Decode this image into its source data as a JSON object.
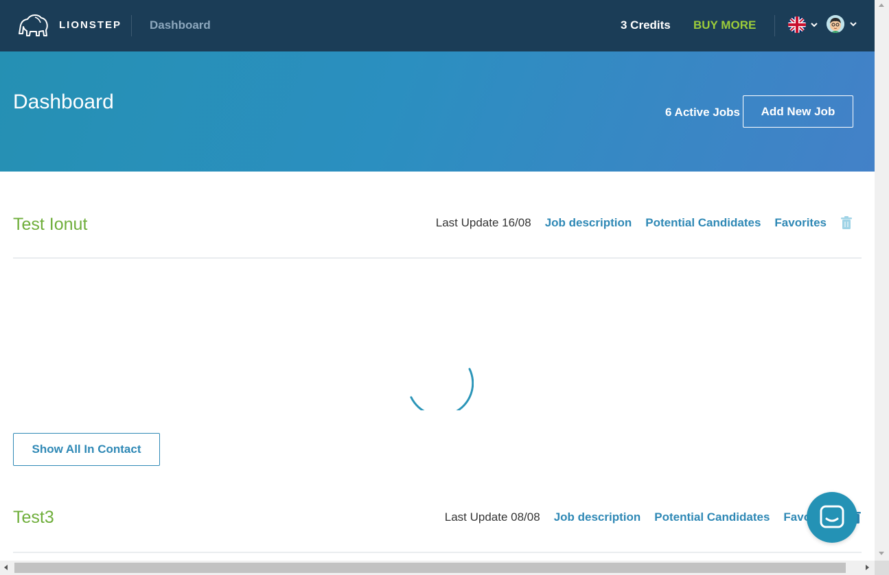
{
  "nav": {
    "brand": "LIONSTEP",
    "current_page": "Dashboard",
    "credits": "3 Credits",
    "buy_more": "BUY MORE",
    "language_icon": "uk-flag-icon",
    "avatar_icon": "user-avatar-icon"
  },
  "hero": {
    "title": "Dashboard",
    "active_jobs": "6 Active Jobs",
    "add_job_label": "Add New Job"
  },
  "jobs": [
    {
      "title": "Test Ionut",
      "last_update": "Last Update 16/08",
      "links": [
        "Job description",
        "Potential Candidates",
        "Favorites"
      ],
      "show_all_label": "Show All In Contact"
    },
    {
      "title": "Test3",
      "last_update": "Last Update 08/08",
      "links": [
        "Job description",
        "Potential Candidates",
        "Favorites"
      ]
    }
  ],
  "colors": {
    "nav_bg": "#1b3d57",
    "accent_green": "#6fae3b",
    "buy_more": "#9ccc3a",
    "link_blue": "#2e88b5",
    "chat_bubble": "#2492b5"
  }
}
